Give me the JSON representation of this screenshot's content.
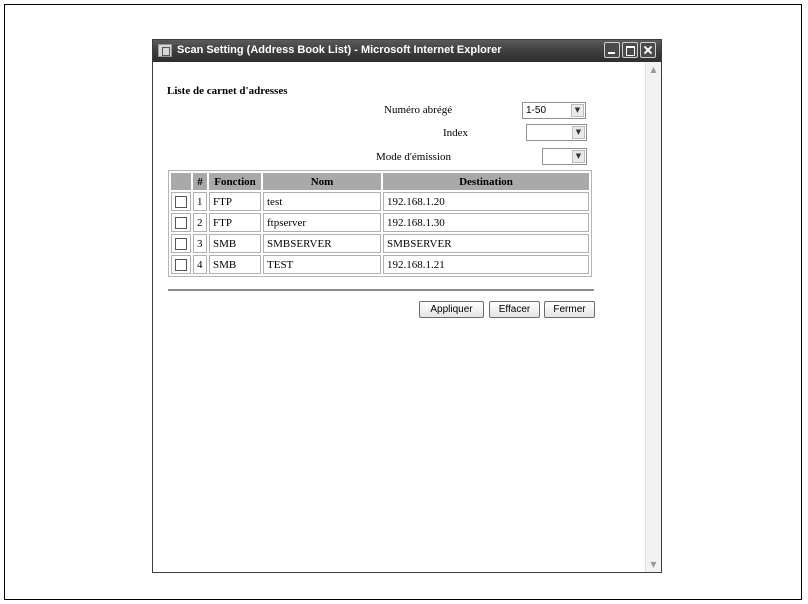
{
  "window": {
    "title": "Scan Setting (Address Book List) - Microsoft Internet Explorer"
  },
  "page": {
    "heading": "Liste de carnet d'adresses"
  },
  "filters": {
    "numero_abrege": {
      "label": "Numéro abrégé",
      "value": "1-50"
    },
    "index": {
      "label": "Index",
      "value": ""
    },
    "mode_emission": {
      "label": "Mode d'émission",
      "value": ""
    }
  },
  "table": {
    "headers": [
      "",
      "#",
      "Fonction",
      "Nom",
      "Destination"
    ],
    "rows": [
      {
        "checked": false,
        "num": "1",
        "fonction": "FTP",
        "nom": "test",
        "destination": "192.168.1.20"
      },
      {
        "checked": false,
        "num": "2",
        "fonction": "FTP",
        "nom": "ftpserver",
        "destination": "192.168.1.30"
      },
      {
        "checked": false,
        "num": "3",
        "fonction": "SMB",
        "nom": "SMBSERVER",
        "destination": "SMBSERVER"
      },
      {
        "checked": false,
        "num": "4",
        "fonction": "SMB",
        "nom": "TEST",
        "destination": "192.168.1.21"
      }
    ]
  },
  "buttons": {
    "apply": "Appliquer",
    "clear": "Effacer",
    "close": "Fermer"
  },
  "icons": {
    "window": "ie-window-icon",
    "dropdown": "chevron-down-icon"
  },
  "colors": {
    "titlebar": "#3c3c3c",
    "table_header": "#a9a9a9"
  }
}
